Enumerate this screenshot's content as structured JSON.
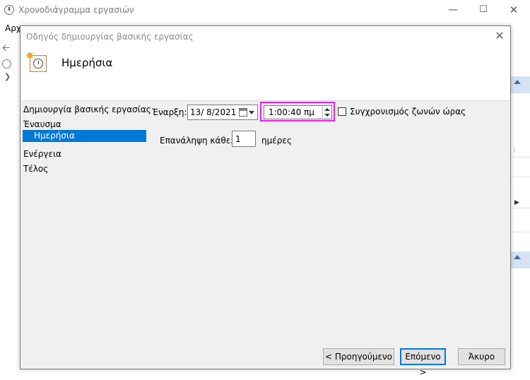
{
  "background_window": {
    "title": "Χρονοδιάγραμμα εργασιών",
    "menu_partial": "Αρχ"
  },
  "dialog": {
    "title": "Οδηγός δημιουργίας βασικής εργασίας",
    "header_title": "Ημερήσια",
    "nav": {
      "items": [
        "Δημιουργία βασικής εργασίας",
        "Έναυσμα",
        "Ημερήσια",
        "Ενέργεια",
        "Τέλος"
      ],
      "selected": "Ημερήσια"
    },
    "start": {
      "label": "Έναρξη:",
      "date_value": "13/  8/2021",
      "time_value": "1:00:40 πμ"
    },
    "sync": {
      "label": "Συγχρονισμός ζωνών ώρας",
      "checked": false
    },
    "repeat": {
      "label": "Επανάληψη κάθε:",
      "value": "1",
      "unit": "ημέρες"
    },
    "buttons": {
      "previous": "< Προηγούμενο",
      "next": "Επόμενο >",
      "cancel": "Άκυρο"
    }
  },
  "colors": {
    "selection": "#0078d7",
    "highlight": "#e81ee8",
    "panel_strip": "#d5e3f3"
  },
  "icons": [
    "clock-icon",
    "back-arrow-icon",
    "calendar-icon",
    "close-icon",
    "minimize-icon",
    "maximize-icon",
    "checkbox-icon",
    "spinner-icon"
  ]
}
